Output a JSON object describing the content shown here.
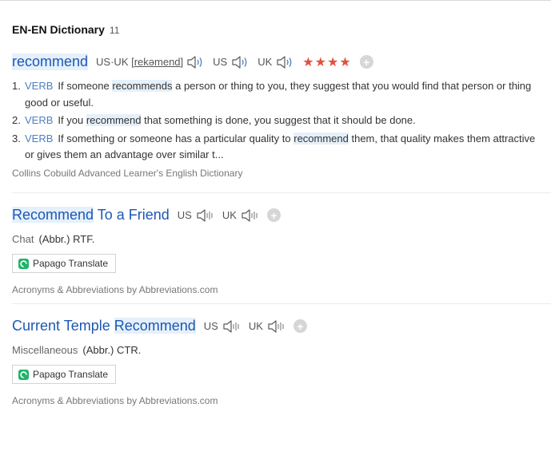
{
  "header": {
    "title": "EN-EN Dictionary",
    "count": "11"
  },
  "colors": {
    "link_blue": "#1c58b4",
    "highlight": "#e5f0fb",
    "star_red": "#e0523f",
    "pos_blue": "#4e7fc2"
  },
  "entries": [
    {
      "headword": "recommend",
      "pron_prefix": "US·UK [",
      "pron_text": "rekəmend",
      "pron_suffix": "]",
      "us_label": "US",
      "uk_label": "UK",
      "rating_stars": "★★★★",
      "rating": 4,
      "senses": [
        {
          "num": "1.",
          "pos": "VERB",
          "before": "If someone ",
          "hl": "recommends",
          "after": " a person or thing to you, they suggest that you would find that person or thing good or useful."
        },
        {
          "num": "2.",
          "pos": "VERB",
          "before": "If you ",
          "hl": "recommend",
          "after": " that something is done, you suggest that it should be done."
        },
        {
          "num": "3.",
          "pos": "VERB",
          "before": "If something or someone has a particular quality to ",
          "hl": "recommend",
          "after": " them, that quality makes them attractive or gives them an advantage over similar t..."
        }
      ],
      "source": "Collins Cobuild Advanced Learner's English Dictionary"
    },
    {
      "headword_hl": "Recommend",
      "headword_rest": " To a Friend",
      "us_label": "US",
      "uk_label": "UK",
      "category": "Chat",
      "abbr": "(Abbr.) RTF.",
      "translate_label": "Papago Translate",
      "source": "Acronyms & Abbreviations by Abbreviations.com"
    },
    {
      "headword_rest": "Current Temple ",
      "headword_hl": "Recommend",
      "us_label": "US",
      "uk_label": "UK",
      "category": "Miscellaneous",
      "abbr": "(Abbr.) CTR.",
      "translate_label": "Papago Translate",
      "source": "Acronyms & Abbreviations by Abbreviations.com"
    }
  ]
}
